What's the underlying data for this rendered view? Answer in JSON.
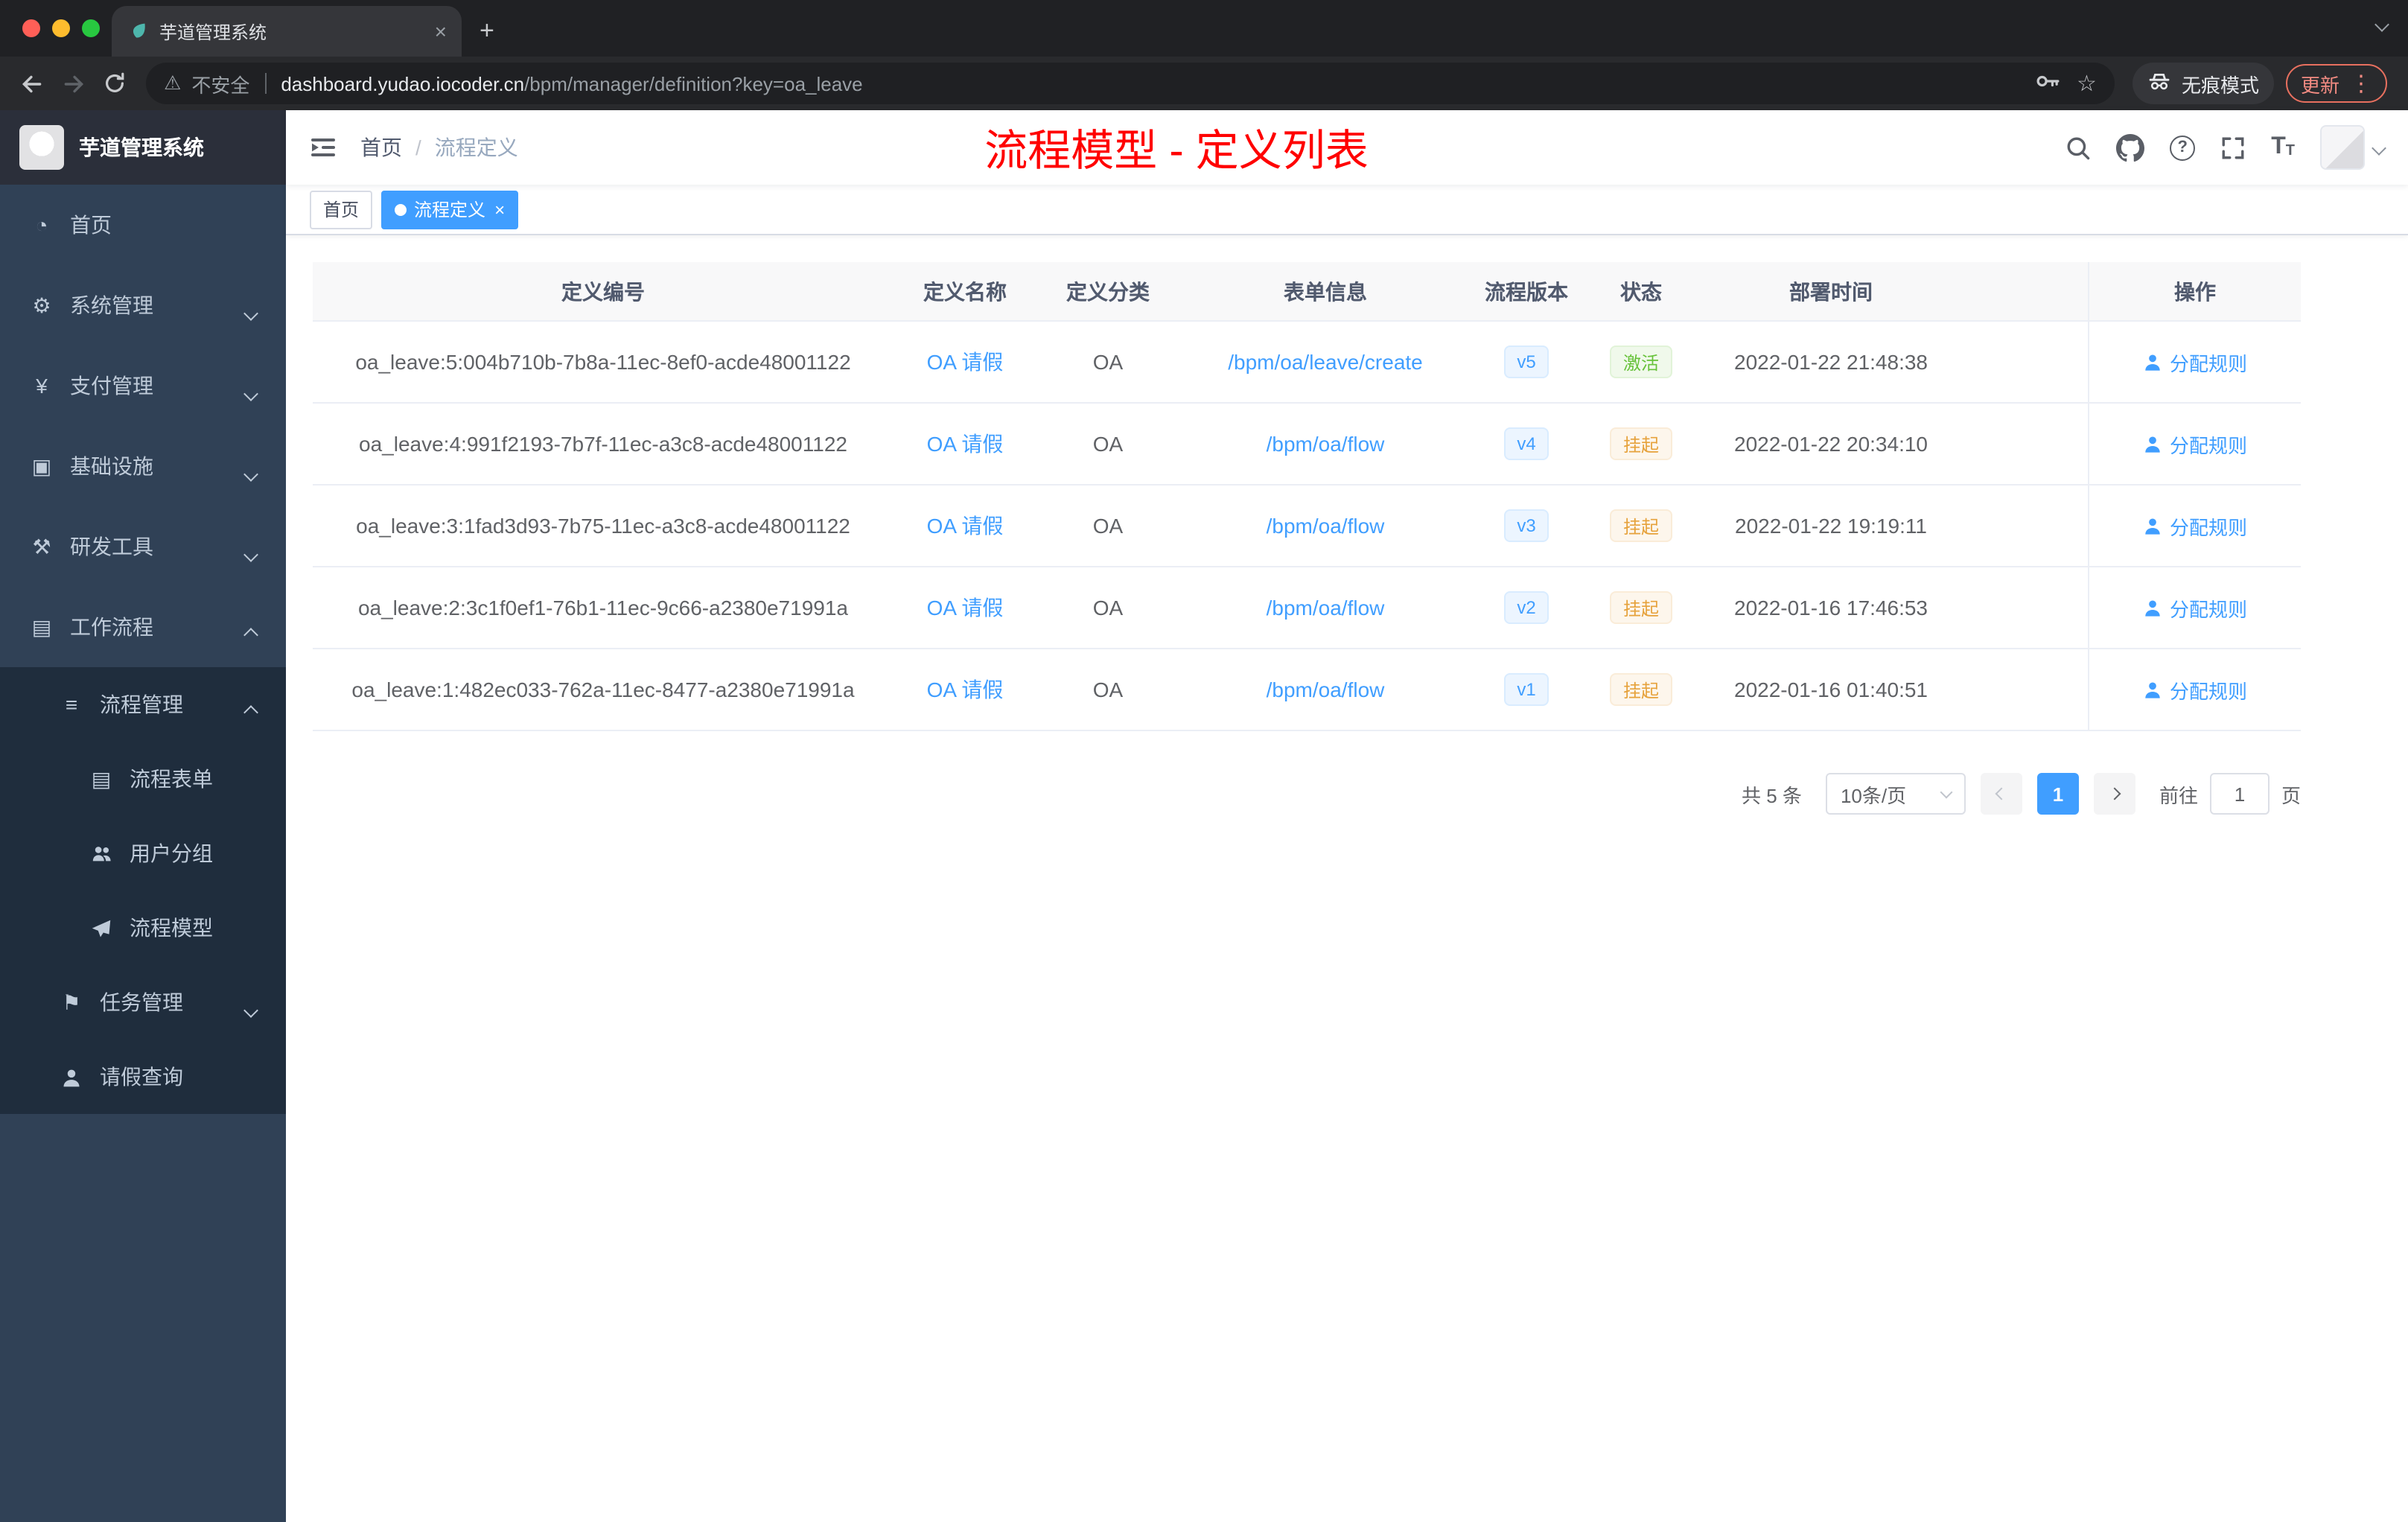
{
  "colors": {
    "accent": "#409eff",
    "success": "#67c23a",
    "warning": "#e6a23c",
    "annotation_red": "#ff0000",
    "sidebar_bg": "#304156",
    "submenu_bg": "#1f2d3d"
  },
  "glyphs": {
    "dashboard": "◔",
    "gear": "⚙",
    "yen": "¥",
    "infrastructure": "▣",
    "tools": "⚒",
    "workflow": "▤",
    "list": "≡",
    "form": "▤",
    "flag": "⚑",
    "close": "×",
    "plus": "+",
    "kebab": "⋮",
    "star": "☆",
    "warning": "⚠",
    "question": "?",
    "text_icon": "T"
  },
  "browser": {
    "tab_title": "芋道管理系统",
    "security_label": "不安全",
    "url_host": "dashboard.yudao.iocoder.cn",
    "url_path": "/bpm/manager/definition?key=oa_leave",
    "incognito_label": "无痕模式",
    "update_label": "更新"
  },
  "sidebar": {
    "logo_title": "芋道管理系统",
    "home": "首页",
    "system": "系统管理",
    "payment": "支付管理",
    "infrastructure": "基础设施",
    "devtools": "研发工具",
    "workflow": "工作流程",
    "process_mgmt": "流程管理",
    "process_form": "流程表单",
    "user_group": "用户分组",
    "process_model": "流程模型",
    "task_mgmt": "任务管理",
    "leave_query": "请假查询"
  },
  "header": {
    "breadcrumb_home": "首页",
    "breadcrumb_sep": "/",
    "breadcrumb_current": "流程定义",
    "annotation": "流程模型 - 定义列表"
  },
  "tags": {
    "home": "首页",
    "current": "流程定义"
  },
  "table": {
    "columns": {
      "id": "定义编号",
      "name": "定义名称",
      "category": "定义分类",
      "form": "表单信息",
      "version": "流程版本",
      "status": "状态",
      "time": "部署时间",
      "op": "操作"
    },
    "rows": [
      {
        "id": "oa_leave:5:004b710b-7b8a-11ec-8ef0-acde48001122",
        "name": "OA 请假",
        "category": "OA",
        "form": "/bpm/oa/leave/create",
        "version": "v5",
        "status": "激活",
        "status_type": "success",
        "time": "2022-01-22 21:48:38",
        "action": "分配规则"
      },
      {
        "id": "oa_leave:4:991f2193-7b7f-11ec-a3c8-acde48001122",
        "name": "OA 请假",
        "category": "OA",
        "form": "/bpm/oa/flow",
        "version": "v4",
        "status": "挂起",
        "status_type": "warning",
        "time": "2022-01-22 20:34:10",
        "action": "分配规则"
      },
      {
        "id": "oa_leave:3:1fad3d93-7b75-11ec-a3c8-acde48001122",
        "name": "OA 请假",
        "category": "OA",
        "form": "/bpm/oa/flow",
        "version": "v3",
        "status": "挂起",
        "status_type": "warning",
        "time": "2022-01-22 19:19:11",
        "action": "分配规则"
      },
      {
        "id": "oa_leave:2:3c1f0ef1-76b1-11ec-9c66-a2380e71991a",
        "name": "OA 请假",
        "category": "OA",
        "form": "/bpm/oa/flow",
        "version": "v2",
        "status": "挂起",
        "status_type": "warning",
        "time": "2022-01-16 17:46:53",
        "action": "分配规则"
      },
      {
        "id": "oa_leave:1:482ec033-762a-11ec-8477-a2380e71991a",
        "name": "OA 请假",
        "category": "OA",
        "form": "/bpm/oa/flow",
        "version": "v1",
        "status": "挂起",
        "status_type": "warning",
        "time": "2022-01-16 01:40:51",
        "action": "分配规则"
      }
    ]
  },
  "pagination": {
    "total": "共 5 条",
    "page_size": "10条/页",
    "page": "1",
    "goto_before": "前往",
    "goto_value": "1",
    "goto_after": "页"
  }
}
